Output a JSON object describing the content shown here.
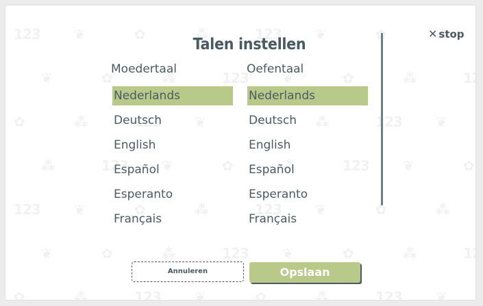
{
  "dialog": {
    "title": "Talen instellen",
    "stop_label": "stop"
  },
  "columns": {
    "native": {
      "heading": "Moedertaal",
      "items": [
        "Nederlands",
        "Deutsch",
        "English",
        "Español",
        "Esperanto",
        "Français"
      ],
      "selected": "Nederlands"
    },
    "practice": {
      "heading": "Oefentaal",
      "items": [
        "Nederlands",
        "Deutsch",
        "English",
        "Español",
        "Esperanto",
        "Français"
      ],
      "selected": "Nederlands"
    }
  },
  "buttons": {
    "cancel_label": "Annuleren",
    "save_label": "Opslaan"
  },
  "colors": {
    "accent": "#b8c98a",
    "text": "#4a5a63",
    "background": "#ffffff"
  },
  "icons": {
    "stop": "close-icon"
  }
}
